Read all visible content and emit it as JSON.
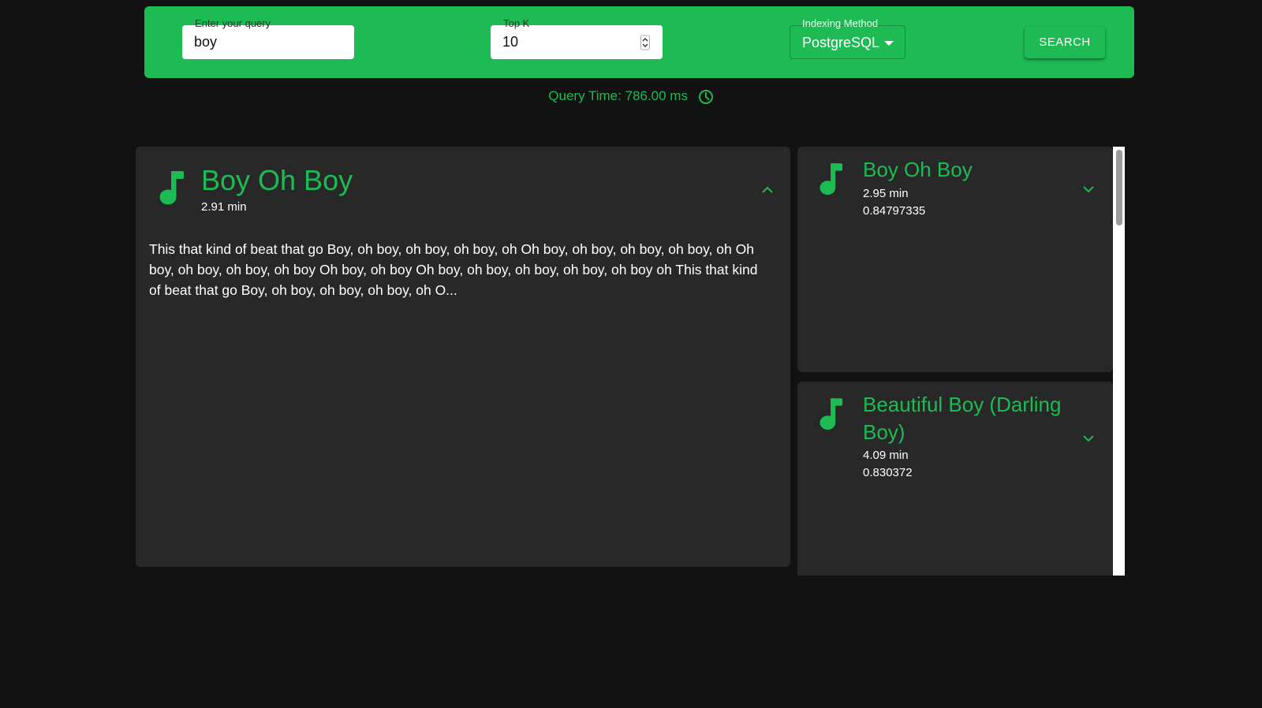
{
  "search": {
    "query_label": "Enter your query",
    "query_value": "boy",
    "topk_label": "Top K",
    "topk_value": "10",
    "method_label": "Indexing Method",
    "method_value": "PostgreSQL",
    "button_label": "SEARCH"
  },
  "status": {
    "query_time": "Query Time: 786.00 ms"
  },
  "selected": {
    "title": "Boy Oh Boy",
    "duration": "2.91 min",
    "lyrics": "This that kind of beat that go Boy, oh boy, oh boy, oh boy, oh Oh boy, oh boy, oh boy, oh boy, oh Oh boy, oh boy, oh boy, oh boy Oh boy, oh boy Oh boy, oh boy, oh boy, oh boy, oh boy oh This that kind of beat that go Boy, oh boy, oh boy, oh boy, oh O..."
  },
  "results": [
    {
      "title": "Boy Oh Boy",
      "duration": "2.95 min",
      "score": "0.84797335"
    },
    {
      "title": "Beautiful Boy (Darling Boy)",
      "duration": "4.09 min",
      "score": "0.830372"
    }
  ],
  "colors": {
    "accent": "#1ebb54",
    "background": "#121212",
    "card": "#282828"
  },
  "icons": {
    "song": "music-note-icon",
    "clock": "clock-icon",
    "expand": "chevron-down-icon",
    "collapse": "chevron-up-icon",
    "dropdown": "caret-down-icon"
  }
}
